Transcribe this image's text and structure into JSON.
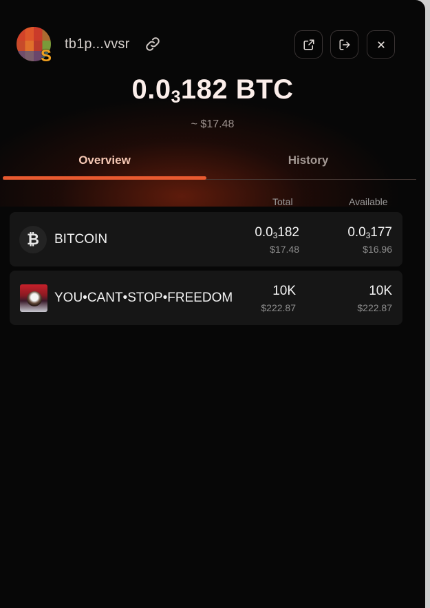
{
  "header": {
    "address": "tb1p...vvsr",
    "avatar_badge": "S",
    "icons": [
      "link-icon",
      "external-link-icon",
      "logout-icon",
      "close-icon"
    ]
  },
  "balance": {
    "prefix": "0.0",
    "zeros_subscript": "3",
    "rest": "182 BTC",
    "fiat": "~ $17.48"
  },
  "tabs": {
    "overview": "Overview",
    "history": "History",
    "active": "Overview"
  },
  "columns": {
    "total": "Total",
    "available": "Available"
  },
  "tokens": [
    {
      "name": "BITCOIN",
      "icon": "bitcoin-icon",
      "icon_glyph": "₿",
      "total": {
        "prefix": "0.0",
        "sub": "3",
        "rest": "182",
        "fiat": "$17.48"
      },
      "available": {
        "prefix": "0.0",
        "sub": "3",
        "rest": "177",
        "fiat": "$16.96"
      }
    },
    {
      "name": "YOU•CANT•STOP•FREEDOM",
      "icon": "eagle-flag-image",
      "total": {
        "value": "10K",
        "fiat": "$222.87"
      },
      "available": {
        "value": "10K",
        "fiat": "$222.87"
      }
    }
  ],
  "colors": {
    "accent": "#e85a30",
    "background": "#070707",
    "row_background": "#161616"
  }
}
